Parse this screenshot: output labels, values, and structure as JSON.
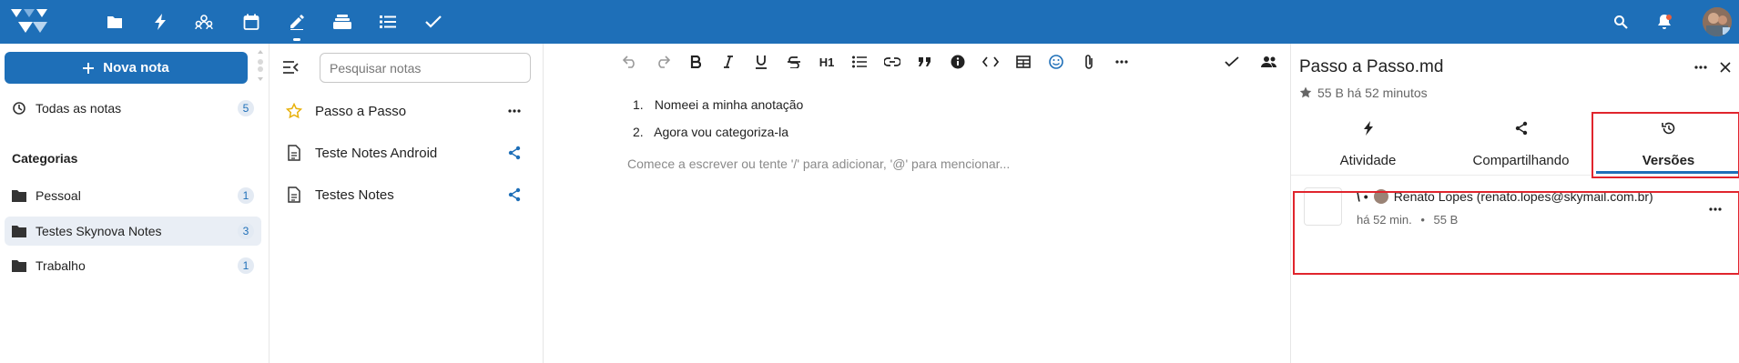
{
  "topbar": {
    "apps": [
      {
        "name": "files-icon"
      },
      {
        "name": "activity-icon"
      },
      {
        "name": "contacts-icon"
      },
      {
        "name": "calendar-icon"
      },
      {
        "name": "notes-icon"
      },
      {
        "name": "deck-icon"
      },
      {
        "name": "tasks-icon"
      },
      {
        "name": "checkmark-icon"
      }
    ],
    "active_app": "notes",
    "colors": {
      "bar": "#1e6fb8",
      "icon": "#ffffff"
    }
  },
  "leftnav": {
    "new_note_label": "Nova nota",
    "all_notes": {
      "label": "Todas as notas",
      "count": "5"
    },
    "categories_heading": "Categorias",
    "categories": [
      {
        "label": "Pessoal",
        "count": "1"
      },
      {
        "label": "Testes Skynova Notes",
        "count": "3"
      },
      {
        "label": "Trabalho",
        "count": "1"
      }
    ]
  },
  "noteslist": {
    "search_placeholder": "Pesquisar notas",
    "notes": [
      {
        "title": "Passo a Passo",
        "favorite": true
      },
      {
        "title": "Teste Notes Android",
        "shared": true
      },
      {
        "title": "Testes Notes",
        "shared": true
      }
    ]
  },
  "editor": {
    "toolbar": [
      "undo-icon",
      "redo-icon",
      "bold-icon",
      "italic-icon",
      "underline-icon",
      "strikethrough-icon",
      "heading-icon",
      "bullet-list-icon",
      "link-icon",
      "quote-icon",
      "info-icon",
      "code-icon",
      "table-icon",
      "emoji-icon",
      "attachment-icon",
      "more-icon"
    ],
    "heading_label": "H1",
    "list": [
      {
        "num": "1.",
        "text": "Nomeei a minha anotação"
      },
      {
        "num": "2.",
        "text": "Agora vou categoriza-la"
      }
    ],
    "placeholder": "Comece a escrever ou tente '/' para adicionar, '@' para mencionar..."
  },
  "sidebar": {
    "title": "Passo a Passo.md",
    "meta": "55 B há 52 minutos",
    "tabs": [
      {
        "label": "Atividade",
        "icon": "activity-icon"
      },
      {
        "label": "Compartilhando",
        "icon": "share-icon"
      },
      {
        "label": "Versões",
        "icon": "history-icon",
        "active": true
      }
    ],
    "version": {
      "label_prefix": "\\ •",
      "author": "Renato Lopes (renato.lopes@skymail.com.br)",
      "time": "há 52 min.",
      "size": "55 B",
      "separator": "•"
    },
    "highlight_color": "#e0252d",
    "accent": "#1e6fb8"
  }
}
